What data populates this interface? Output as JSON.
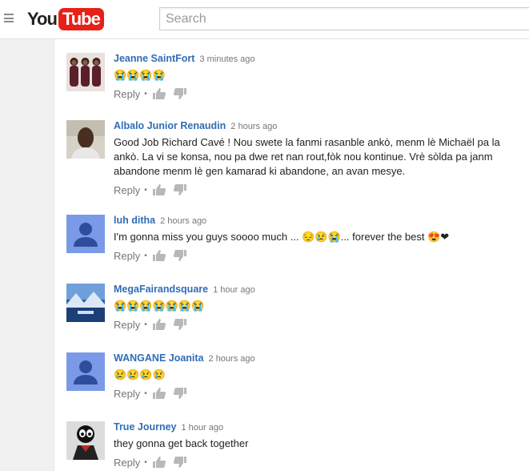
{
  "header": {
    "logo_you": "You",
    "logo_tube": "Tube",
    "search_placeholder": "Search"
  },
  "comments": [
    {
      "author": "Jeanne SaintFort",
      "time": "3 minutes ago",
      "text": "😭😭😭😭",
      "reply": "Reply",
      "dot": "•"
    },
    {
      "author": "Albalo Junior Renaudin",
      "time": "2 hours ago",
      "text": "Good Job Richard Cavé ! Nou swete la fanmi rasanble ankò, menm lè Michaël pa la ankò. La vi se konsa, nou pa dwe ret nan rout,fòk nou kontinue. Vrè sòlda pa janm abandone menm lè gen kamarad ki abandone, an avan mesye.",
      "reply": "Reply",
      "dot": "•"
    },
    {
      "author": "luh ditha",
      "time": "2 hours ago",
      "text": "I'm gonna miss you guys soooo much ... 😔😢😭... forever the best 😍❤",
      "reply": "Reply",
      "dot": "•"
    },
    {
      "author": "MegaFairandsquare",
      "time": "1 hour ago",
      "text": "😭😭😭😭😭😭😭",
      "reply": "Reply",
      "dot": "•"
    },
    {
      "author": "WANGANE Joanita",
      "time": "2 hours ago",
      "text": "😢😢😢😢",
      "reply": "Reply",
      "dot": "•"
    },
    {
      "author": "True Journey",
      "time": "1 hour ago",
      "text": "they gonna get back together",
      "reply": "Reply",
      "dot": "•"
    }
  ],
  "colors": {
    "author_link": "#2f6db5",
    "logo_red": "#e62117",
    "placeholder_avatar": "#7a9ae8"
  },
  "icons": [
    "menu-icon",
    "thumbs-up-icon",
    "thumbs-down-icon"
  ]
}
